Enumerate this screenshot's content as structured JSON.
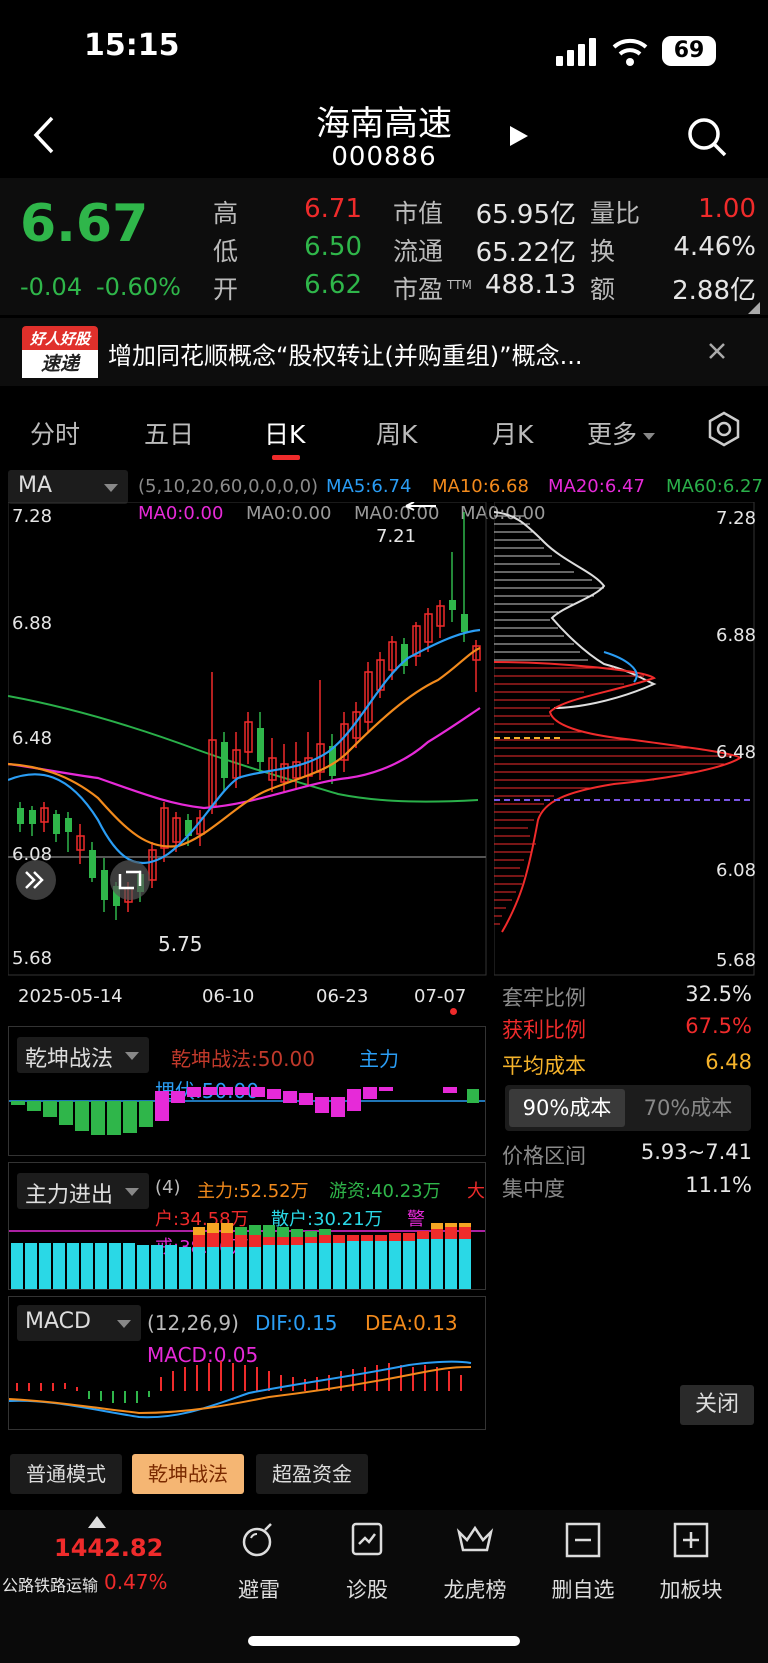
{
  "status_bar": {
    "time": "15:15",
    "battery": "69"
  },
  "header": {
    "title": "海南高速",
    "code": "000886"
  },
  "quote": {
    "price": "6.67",
    "change": "-0.04",
    "change_pct": "-0.60%",
    "high_label": "高",
    "high": "6.71",
    "low_label": "低",
    "low": "6.50",
    "open_label": "开",
    "open": "6.62",
    "mktcap_label": "市值",
    "mktcap": "65.95亿",
    "float_label": "流通",
    "float": "65.22亿",
    "pe_label": "市盈",
    "pe_sup": "TTM",
    "pe": "488.13",
    "vol_ratio_label": "量比",
    "vol_ratio": "1.00",
    "turnover_label": "换",
    "turnover": "4.46%",
    "amount_label": "额",
    "amount": "2.88亿"
  },
  "news": {
    "badge_top": "好人好股",
    "badge_bottom": "速递",
    "text": "增加同花顺概念“股权转让(并购重组)”概念..."
  },
  "tabs": [
    "分时",
    "五日",
    "日K",
    "周K",
    "月K",
    "更多"
  ],
  "ma": {
    "select": "MA",
    "params": "(5,10,20,60,0,0,0,0)",
    "ma5": "MA5:6.74",
    "ma10": "MA10:6.68",
    "ma20": "MA20:6.47",
    "ma60": "MA60:6.27",
    "ma0": [
      "MA0:0.00",
      "MA0:0.00",
      "MA0:0.00",
      "MA0:0.00"
    ],
    "colors": {
      "ma5": "#2a9df4",
      "ma10": "#f28a1c",
      "ma20": "#e62ad8",
      "ma60": "#2ab04a"
    }
  },
  "kline": {
    "y_labels": [
      "7.28",
      "6.88",
      "6.48",
      "6.08",
      "5.68"
    ],
    "high_marker": "7.21",
    "low_marker": "5.75",
    "dates": [
      "2025-05-14",
      "06-10",
      "06-23",
      "07-07"
    ]
  },
  "chip": {
    "y_labels": [
      "7.28",
      "6.88",
      "6.48",
      "6.08",
      "5.68"
    ],
    "trapped_label": "套牢比例",
    "trapped": "32.5%",
    "profit_label": "获利比例",
    "profit": "67.5%",
    "avg_cost_label": "平均成本",
    "avg_cost": "6.48",
    "tab_90": "90%成本",
    "tab_70": "70%成本",
    "range_label": "价格区间",
    "range": "5.93~7.41",
    "conc_label": "集中度",
    "conc": "11.1%",
    "close": "关闭"
  },
  "qkzf": {
    "select": "乾坤战法",
    "value": "乾坤战法:50.00",
    "main": "主力",
    "ambush": "埋伏:50.00"
  },
  "zljc": {
    "select": "主力进出",
    "period": "(4)",
    "main": "主力:52.52万",
    "hot": "游资:40.23万",
    "big_a": "大",
    "big_b": "户:34.58万",
    "retail": "散户:30.21万",
    "alert_a": "警",
    "alert_b": "戒:38.00万"
  },
  "macd": {
    "select": "MACD",
    "params": "(12,26,9)",
    "dif": "DIF:0.15",
    "dea": "DEA:0.13",
    "macd": "MACD:0.05"
  },
  "modes": [
    "普通模式",
    "乾坤战法",
    "超盈资金"
  ],
  "bottom": {
    "index_value": "1442.82",
    "index_name": "公路铁路运输",
    "index_pct": "0.47%",
    "items": [
      "避雷",
      "诊股",
      "龙虎榜",
      "删自选",
      "加板块"
    ]
  }
}
